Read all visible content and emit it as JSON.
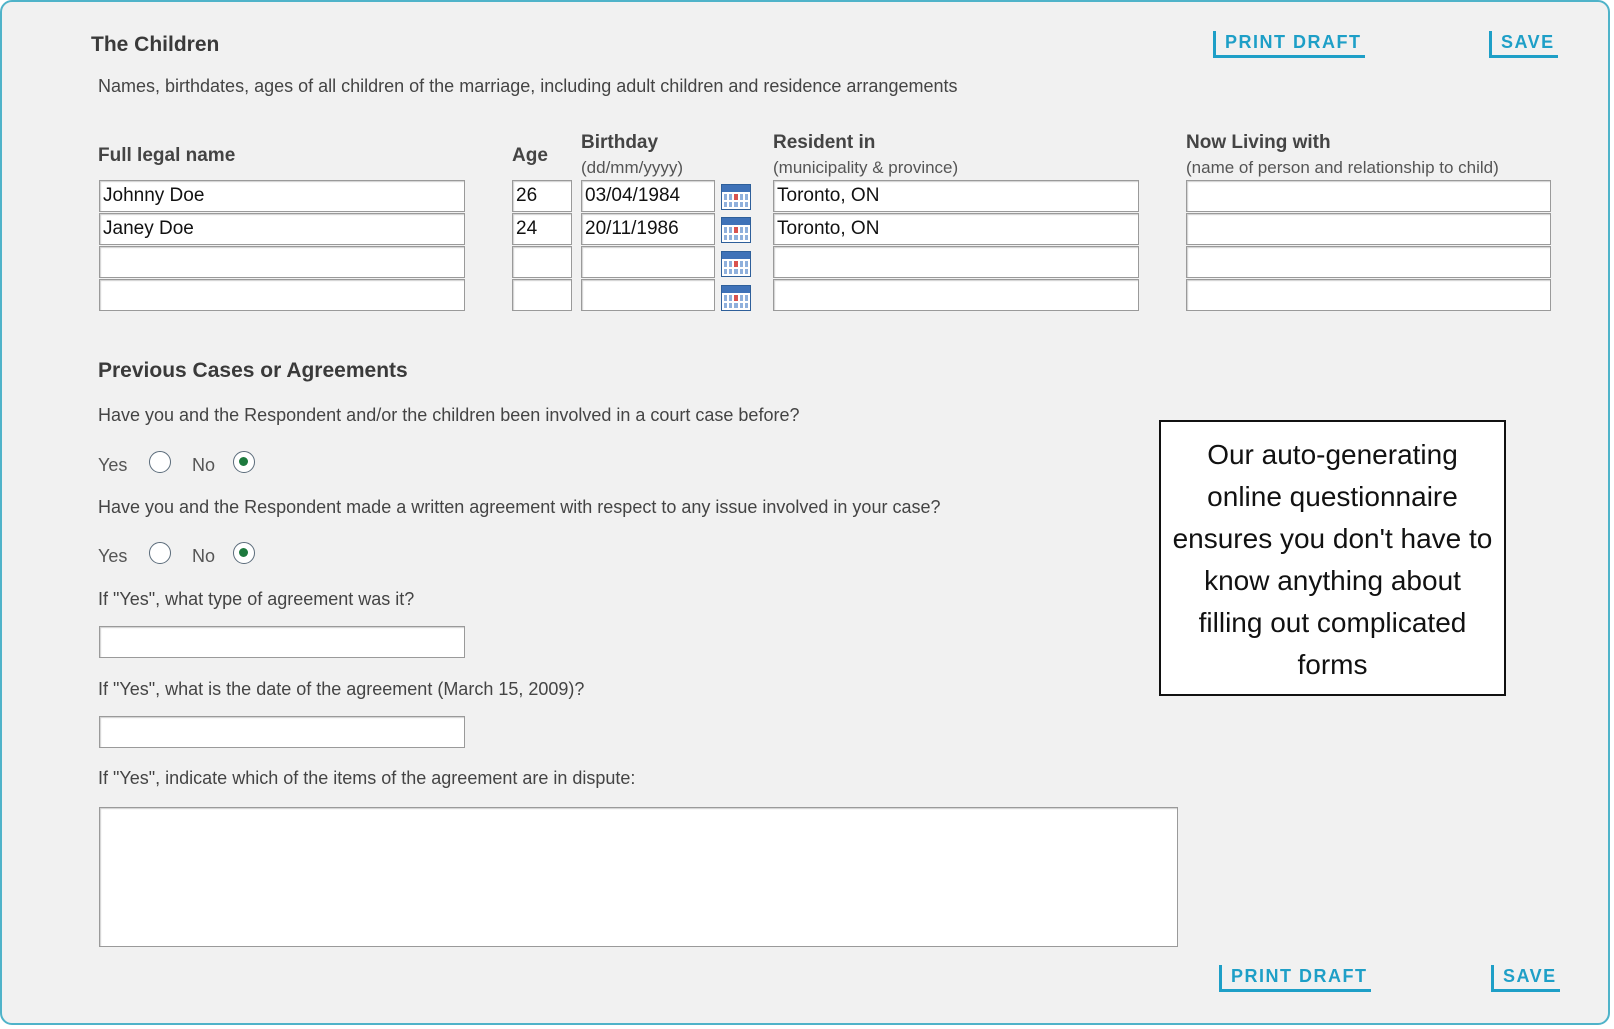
{
  "actions": {
    "print_draft": "PRINT DRAFT",
    "save": "SAVE"
  },
  "children_section": {
    "title": "The Children",
    "description": "Names, birthdates, ages of all children of the marriage, including adult children and residence arrangements",
    "columns": {
      "name": "Full legal name",
      "age": "Age",
      "birthday": "Birthday",
      "birthday_hint": "(dd/mm/yyyy)",
      "resident": "Resident in",
      "resident_hint": "(municipality & province)",
      "living": "Now Living with",
      "living_hint": "(name of person and relationship to child)"
    },
    "rows": [
      {
        "name": "Johnny Doe",
        "age": "26",
        "birthday": "03/04/1984",
        "resident": "Toronto, ON",
        "living": ""
      },
      {
        "name": "Janey Doe",
        "age": "24",
        "birthday": "20/11/1986",
        "resident": "Toronto, ON",
        "living": ""
      },
      {
        "name": "",
        "age": "",
        "birthday": "",
        "resident": "",
        "living": ""
      },
      {
        "name": "",
        "age": "",
        "birthday": "",
        "resident": "",
        "living": ""
      }
    ]
  },
  "previous_section": {
    "title": "Previous Cases or Agreements",
    "q1": "Have you and the Respondent and/or the children been involved in a court case before?",
    "q1_answer": "No",
    "q2": "Have you and the Respondent made a written agreement with respect to any issue involved in your case?",
    "q2_answer": "No",
    "yes_label": "Yes",
    "no_label": "No",
    "q3": "If \"Yes\", what type of agreement was it?",
    "q3_value": "",
    "q4": "If \"Yes\", what is the date of the agreement (March 15, 2009)?",
    "q4_value": "",
    "q5": "If \"Yes\", indicate which of the items of the agreement are in dispute:",
    "q5_value": ""
  },
  "callout": {
    "text": "Our auto-generating online questionnaire ensures you don't have to know anything about filling out complicated forms"
  }
}
